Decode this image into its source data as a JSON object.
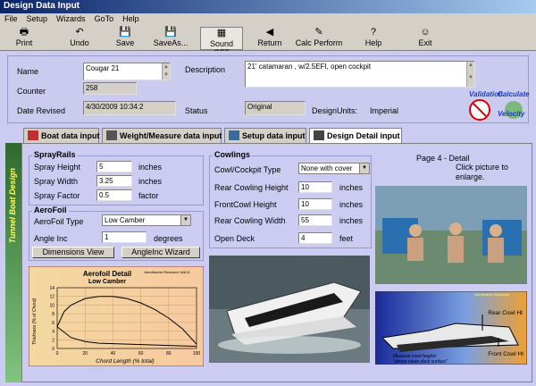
{
  "window": {
    "title": "Design Data Input"
  },
  "menu": [
    "File",
    "Setup",
    "Wizards",
    "GoTo",
    "Help"
  ],
  "toolbar": [
    {
      "label": "Print",
      "icon": "🖶"
    },
    {
      "label": "Undo",
      "icon": "↶"
    },
    {
      "label": "Save",
      "icon": "💾"
    },
    {
      "label": "SaveAs...",
      "icon": "💾"
    },
    {
      "label": "Sound OFF",
      "icon": "▦"
    },
    {
      "label": "Return",
      "icon": "◀"
    },
    {
      "label": "Calc Perform",
      "icon": "✎"
    },
    {
      "label": "Help",
      "icon": "?"
    },
    {
      "label": "Exit",
      "icon": "☺"
    }
  ],
  "header": {
    "name_label": "Name",
    "name_value": "Cougar 21",
    "counter_label": "Counter",
    "counter_value": "258",
    "date_label": "Date Revised",
    "date_value": "4/30/2009 10:34:2",
    "description_label": "Description",
    "description_value": "21' catamaran , w/2.5EFI, open cockpit",
    "status_label": "Status",
    "status_value": "Original",
    "units_label": "DesignUnits:",
    "units_value": "Imperial",
    "badges": {
      "validation": "Validation",
      "calculate": "Calculate",
      "velocity": "Velocity"
    }
  },
  "tabs": [
    {
      "label": "Boat data input"
    },
    {
      "label": "Weight/Measure data input"
    },
    {
      "label": "Setup data input"
    },
    {
      "label": "Design Detail input"
    }
  ],
  "sidebar": {
    "text": "Tunnel Boat Design"
  },
  "sprayrails": {
    "title": "SprayRails",
    "rows": [
      {
        "label": "Spray Height",
        "value": "5",
        "unit": "inches"
      },
      {
        "label": "Spray Width",
        "value": "3.25",
        "unit": "inches"
      },
      {
        "label": "Spray Factor",
        "value": "0.5",
        "unit": "factor"
      }
    ]
  },
  "aerofoil": {
    "title": "AeroFoil",
    "type_label": "AeroFoil Type",
    "type_value": "Low Camber",
    "angle_label": "Angle Inc",
    "angle_value": "1",
    "angle_unit": "degrees",
    "dimensions_button": "Dimensions View",
    "wizard_button": "AngleInc Wizard"
  },
  "cowlings": {
    "title": "Cowlings",
    "type_label": "Cowl/Cockpit Type",
    "type_value": "None with cover",
    "rows": [
      {
        "label": "Rear Cowling Height",
        "value": "10",
        "unit": "inches"
      },
      {
        "label": "FrontCowl Height",
        "value": "10",
        "unit": "inches"
      },
      {
        "label": "Rear Cowling Width",
        "value": "55",
        "unit": "inches"
      },
      {
        "label": "Open Deck",
        "value": "4",
        "unit": "feet"
      }
    ]
  },
  "detail": {
    "page": "Page 4 - Detail",
    "hint": "Click picture to\nenlarge."
  },
  "chart_data": {
    "type": "line",
    "title": "Aerofoil Detail",
    "subtitle": "Low Camber",
    "stamp": "AeroMarine Research NACA",
    "xlabel": "Chord Length (% total)",
    "ylabel": "Thickness (% of Chord)",
    "xlim": [
      0,
      100
    ],
    "ylim": [
      0,
      14
    ],
    "xticks": [
      0,
      20,
      40,
      60,
      80,
      100
    ],
    "yticks": [
      0,
      2,
      4,
      6,
      8,
      10,
      12,
      14
    ],
    "series": [
      {
        "x": [
          0,
          5,
          10,
          20,
          30,
          40,
          50,
          60,
          70,
          80,
          90,
          100
        ],
        "y": [
          5,
          8.5,
          10,
          11.5,
          12,
          12,
          11.5,
          10.5,
          9,
          7,
          4.5,
          1
        ]
      },
      {
        "x": [
          0,
          10,
          20,
          30,
          40,
          50,
          60,
          70,
          80,
          90,
          100
        ],
        "y": [
          5,
          2.5,
          1.6,
          1.2,
          1.1,
          1.0,
          0.9,
          0.8,
          0.7,
          0.6,
          0.5
        ]
      }
    ]
  },
  "diagram": {
    "brand": "AeroMarine Research",
    "rear_label": "Rear Cowl Ht",
    "front_label": "Front Cowl Ht",
    "note": "Measure cowl heights\n\"above mean deck surface\""
  }
}
